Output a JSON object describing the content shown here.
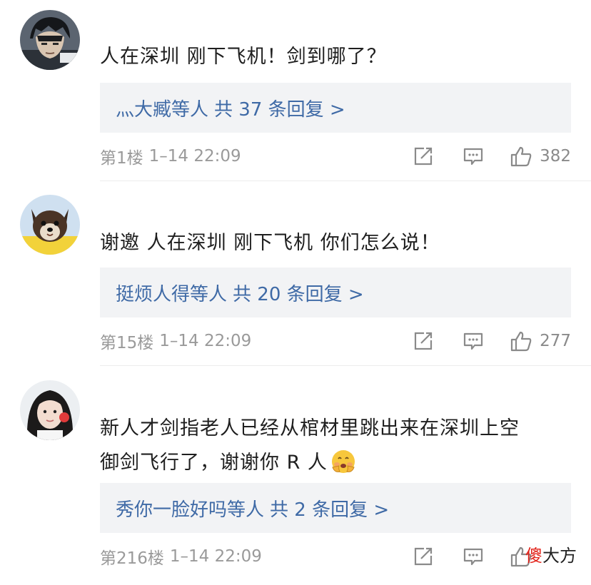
{
  "comments": [
    {
      "text": "人在深圳 刚下飞机！剑到哪了？",
      "reply_users": "灬大臧等人",
      "reply_count": "共 37 条回复 >",
      "floor": "第1楼",
      "time": "1–14 22:09",
      "likes": "382",
      "avatar_icon": "anime-boy-avatar"
    },
    {
      "text": "谢邀 人在深圳 刚下飞机 你们怎么说！",
      "reply_users": "挺烦人得等人",
      "reply_count": "共 20 条回复 >",
      "floor": "第15楼",
      "time": "1–14 22:09",
      "likes": "277",
      "avatar_icon": "puppy-avatar"
    },
    {
      "text_line1": "新人才剑指老人已经从棺材里跳出来在深圳上空",
      "text_line2": "御剑飞行了，谢谢你 R 人",
      "reply_users": "秀你一脸好吗等人",
      "reply_count": "共 2 条回复 >",
      "floor": "第216楼",
      "time": "1–14 22:09",
      "likes": "",
      "avatar_icon": "girl-avatar",
      "emoji_icon": "blushing-hands-emoji"
    }
  ],
  "watermark": {
    "red": "傻",
    "rest": "大方"
  },
  "colors": {
    "link_blue": "#3f6aa6",
    "reply_bg": "#f2f3f5",
    "meta_gray": "#9a9a9a"
  }
}
